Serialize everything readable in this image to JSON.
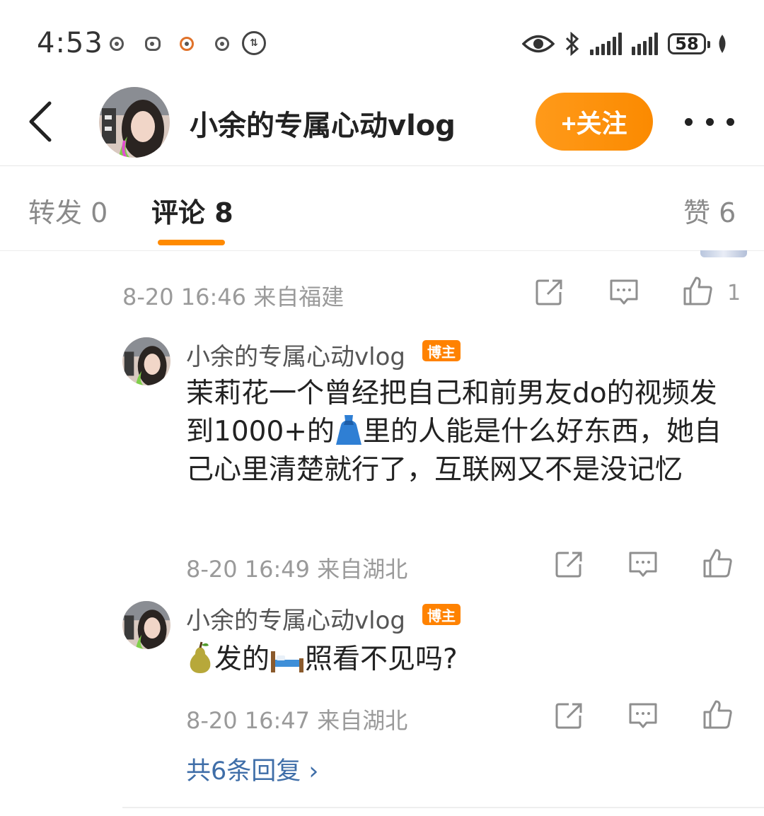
{
  "status_bar": {
    "time": "4:53",
    "battery": "58",
    "icons": [
      "notification-icon",
      "notification-icon",
      "notification-icon",
      "notification-icon",
      "app-icon",
      "eye-icon",
      "bluetooth-icon",
      "signal-icon",
      "signal-icon",
      "battery-icon",
      "leaf-icon"
    ]
  },
  "header": {
    "title": "小余的专属心动vlog",
    "follow_label": "+关注",
    "back_icon": "chevron-left-icon",
    "more_icon": "more-dots-icon"
  },
  "tabs": {
    "repost": "转发 0",
    "comments": "评论 8",
    "likes": "赞 6",
    "active": "comments"
  },
  "parent_comment": {
    "time": "8-20 16:46",
    "location": "来自福建",
    "like_count": "1"
  },
  "replies": [
    {
      "username": "小余的专属心动vlog",
      "badge": "博主",
      "text_part1": "茉莉花一个曾经把自己和前男友do的视频发到1000+的",
      "emoji1": "dress",
      "text_part2": "里的人能是什么好东西，她自己心里清楚就行了，互联网又不是没记忆",
      "time": "8-20 16:49",
      "location": "来自湖北"
    },
    {
      "username": "小余的专属心动vlog",
      "badge": "博主",
      "emoji1": "pear",
      "text_part1": "发的",
      "emoji2": "bed",
      "text_part2": "照看不见吗?",
      "time": "8-20 16:47",
      "location": "来自湖北"
    }
  ],
  "more_replies": "共6条回复 ›",
  "colors": {
    "accent": "#ff8a00",
    "link": "#3f6ea8",
    "badge": "#ff8200",
    "meta_text": "#9a9a9a"
  }
}
